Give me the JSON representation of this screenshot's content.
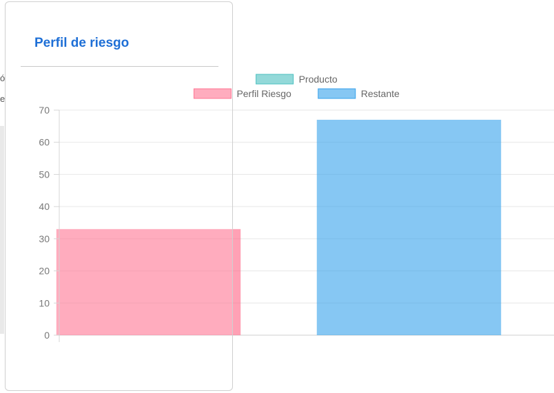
{
  "background_fragments": [
    "ó",
    "e"
  ],
  "card": {
    "title": "Perfil de riesgo"
  },
  "chart_data": {
    "type": "bar",
    "categories": [
      "",
      ""
    ],
    "series": [
      {
        "name": "Producto",
        "color": "#4bc0c0",
        "values": [
          null,
          null
        ]
      },
      {
        "name": "Perfil Riesgo",
        "color": "#ff6384",
        "values": [
          33,
          null
        ]
      },
      {
        "name": "Restante",
        "color": "#36a2eb",
        "values": [
          null,
          67
        ]
      }
    ],
    "ylim": [
      0,
      70
    ],
    "yticks": [
      0,
      10,
      20,
      30,
      40,
      50,
      60,
      70
    ],
    "legend": "top",
    "grid": true
  }
}
